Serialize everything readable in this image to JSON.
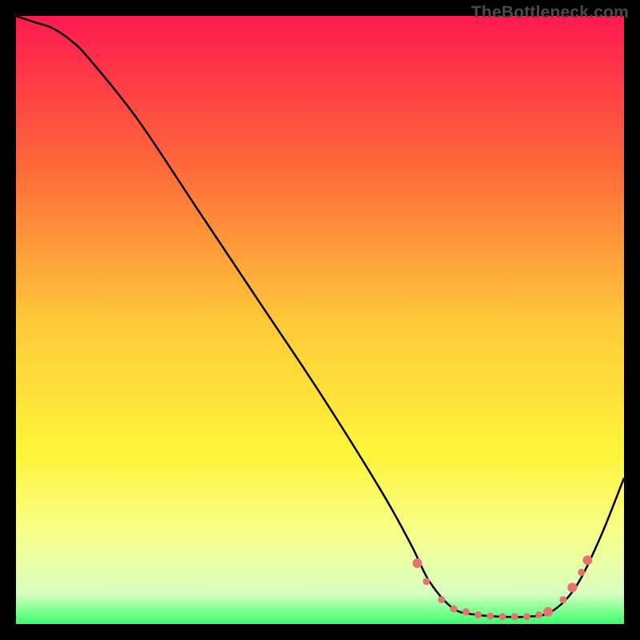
{
  "watermark": "TheBottleneck.com",
  "chart_data": {
    "type": "line",
    "title": "",
    "xlabel": "",
    "ylabel": "",
    "xlim": [
      0,
      100
    ],
    "ylim": [
      0,
      100
    ],
    "background_gradient": {
      "stops": [
        {
          "offset": 0,
          "color": "#ff1a50"
        },
        {
          "offset": 25,
          "color": "#ff6a3a"
        },
        {
          "offset": 50,
          "color": "#ffc83a"
        },
        {
          "offset": 72,
          "color": "#fff53a"
        },
        {
          "offset": 85,
          "color": "#f8ff8a"
        },
        {
          "offset": 95,
          "color": "#d8ffc0"
        },
        {
          "offset": 100,
          "color": "#3aff6a"
        }
      ]
    },
    "series": [
      {
        "name": "bottleneck-curve",
        "color": "#000000",
        "x": [
          0,
          3,
          6,
          9,
          12,
          20,
          30,
          40,
          50,
          60,
          65,
          68,
          72,
          76,
          80,
          84,
          88,
          92,
          96,
          100
        ],
        "y": [
          100,
          99,
          98,
          96,
          93,
          83,
          68,
          53,
          38,
          22,
          13,
          7,
          2.5,
          1.5,
          1.2,
          1.2,
          2,
          6,
          14,
          24
        ]
      }
    ],
    "markers": {
      "name": "highlighted-points",
      "color": "#e57373",
      "radius_small": 4.5,
      "radius_large": 6,
      "points": [
        {
          "x": 66,
          "y": 10,
          "r": "large"
        },
        {
          "x": 67.5,
          "y": 7,
          "r": "small"
        },
        {
          "x": 70,
          "y": 4,
          "r": "small"
        },
        {
          "x": 72,
          "y": 2.5,
          "r": "small"
        },
        {
          "x": 74,
          "y": 2,
          "r": "small"
        },
        {
          "x": 76,
          "y": 1.5,
          "r": "small"
        },
        {
          "x": 78,
          "y": 1.3,
          "r": "small"
        },
        {
          "x": 80,
          "y": 1.2,
          "r": "small"
        },
        {
          "x": 82,
          "y": 1.2,
          "r": "small"
        },
        {
          "x": 84,
          "y": 1.2,
          "r": "small"
        },
        {
          "x": 86,
          "y": 1.5,
          "r": "small"
        },
        {
          "x": 87.5,
          "y": 2,
          "r": "large"
        },
        {
          "x": 90,
          "y": 4,
          "r": "small"
        },
        {
          "x": 91.5,
          "y": 6,
          "r": "large"
        },
        {
          "x": 93,
          "y": 8.5,
          "r": "small"
        },
        {
          "x": 94,
          "y": 10.5,
          "r": "large"
        }
      ]
    }
  }
}
